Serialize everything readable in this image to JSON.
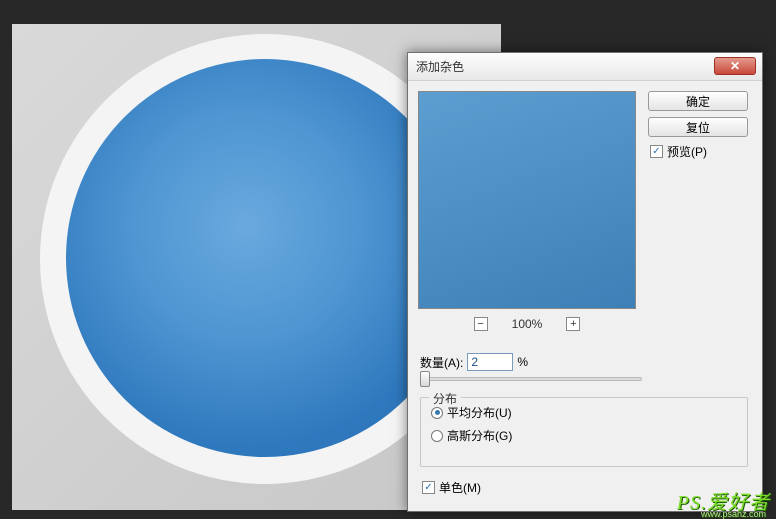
{
  "dialog": {
    "title": "添加杂色",
    "ok_label": "确定",
    "reset_label": "复位",
    "preview_label": "预览(P)",
    "preview_checked": true,
    "zoom": {
      "minus": "−",
      "value": "100%",
      "plus": "+"
    },
    "amount": {
      "label": "数量(A):",
      "value": "2",
      "unit": "%"
    },
    "distribution": {
      "title": "分布",
      "uniform_label": "平均分布(U)",
      "gaussian_label": "高斯分布(G)",
      "selected": "uniform"
    },
    "monochrome": {
      "label": "单色(M)",
      "checked": true
    },
    "close_x": "✕"
  },
  "watermark": {
    "main": "PS.爱好者",
    "sub": "www.psahz.com"
  }
}
